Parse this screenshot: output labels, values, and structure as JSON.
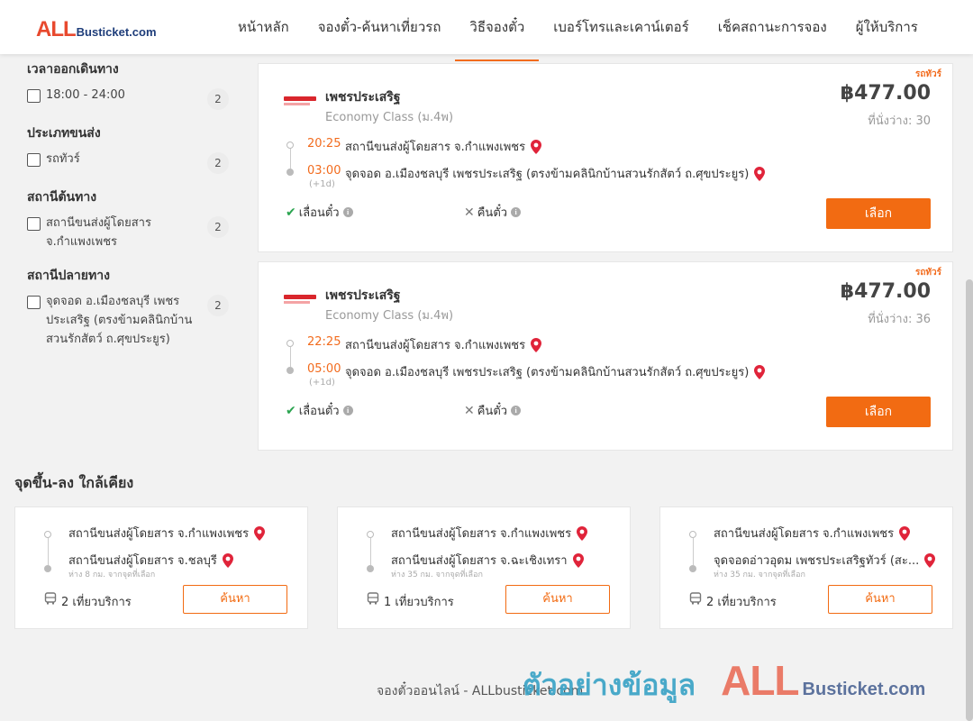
{
  "header": {
    "logo_all": "ALL",
    "logo_rest": "Busticket.com",
    "nav": [
      "หน้าหลัก",
      "จองตั๋ว-ค้นหาเที่ยวรถ",
      "วิธีจองตั๋ว",
      "เบอร์โทรและเคาน์เตอร์",
      "เช็คสถานะการจอง",
      "ผู้ให้บริการ"
    ],
    "active_nav": "วิธีจองตั๋ว"
  },
  "filters": {
    "departure_time": {
      "title": "เวลาออกเดินทาง",
      "option": "18:00 - 24:00",
      "count": "2"
    },
    "vehicle_type": {
      "title": "ประเภทขนส่ง",
      "option": "รถทัวร์",
      "count": "2"
    },
    "origin": {
      "title": "สถานีต้นทาง",
      "option": "สถานีขนส่งผู้โดยสาร จ.กำแพงเพชร",
      "count": "2"
    },
    "destination": {
      "title": "สถานีปลายทาง",
      "option": "จุดจอด อ.เมืองชลบุรี เพชรประเสริฐ (ตรงข้ามคลินิกบ้านสวนรักสัตว์ ถ.ศุขประยูร)",
      "count": "2"
    }
  },
  "trips": [
    {
      "tag": "รถทัวร์",
      "operator": "เพชรประเสริฐ",
      "class": "Economy Class (ม.4พ)",
      "price": "฿477.00",
      "seats": "ที่นั่งว่าง: 30",
      "depart_time": "20:25",
      "depart_place": "สถานีขนส่งผู้โดยสาร จ.กำแพงเพชร",
      "arrive_time": "03:00",
      "arrive_place": "จุดจอด อ.เมืองชลบุรี เพชรประเสริฐ (ตรงข้ามคลินิกบ้านสวนรักสัตว์ ถ.ศุขประยูร)",
      "next_day": "(+1d)",
      "reschedule": "เลื่อนตั๋ว",
      "refund": "คืนตั๋ว",
      "select_label": "เลือก"
    },
    {
      "tag": "รถทัวร์",
      "operator": "เพชรประเสริฐ",
      "class": "Economy Class (ม.4พ)",
      "price": "฿477.00",
      "seats": "ที่นั่งว่าง: 36",
      "depart_time": "22:25",
      "depart_place": "สถานีขนส่งผู้โดยสาร จ.กำแพงเพชร",
      "arrive_time": "05:00",
      "arrive_place": "จุดจอด อ.เมืองชลบุรี เพชรประเสริฐ (ตรงข้ามคลินิกบ้านสวนรักสัตว์ ถ.ศุขประยูร)",
      "next_day": "(+1d)",
      "reschedule": "เลื่อนตั๋ว",
      "refund": "คืนตั๋ว",
      "select_label": "เลือก"
    }
  ],
  "nearby": {
    "title": "จุดขึ้น-ลง ใกล้เคียง",
    "cards": [
      {
        "from": "สถานีขนส่งผู้โดยสาร จ.กำแพงเพชร",
        "to": "สถานีขนส่งผู้โดยสาร จ.ชลบุรี",
        "distance": "ห่าง 8 กม. จากจุดที่เลือก",
        "trips": "2 เที่ยวบริการ",
        "search_label": "ค้นหา"
      },
      {
        "from": "สถานีขนส่งผู้โดยสาร จ.กำแพงเพชร",
        "to": "สถานีขนส่งผู้โดยสาร จ.ฉะเชิงเทรา",
        "distance": "ห่าง 35 กม. จากจุดที่เลือก",
        "trips": "1 เที่ยวบริการ",
        "search_label": "ค้นหา"
      },
      {
        "from": "สถานีขนส่งผู้โดยสาร จ.กำแพงเพชร",
        "to": "จุดจอดอ่าวอุดม เพชรประเสริฐทัวร์ (สะ...",
        "distance": "ห่าง 35 กม. จากจุดที่เลือก",
        "trips": "2 เที่ยวบริการ",
        "search_label": "ค้นหา"
      }
    ]
  },
  "footer": {
    "text": "จองตั๋วออนไลน์ - ALLbusticket.com",
    "watermark_thai": "ตัวอย่างข้อมูล",
    "watermark_all": "ALL",
    "watermark_rest": "Busticket.com"
  },
  "colors": {
    "accent": "#f26b12",
    "pin": "#e0243a",
    "check": "#2aa44f",
    "logo_red": "#e8492e",
    "logo_navy": "#1e3d7a"
  }
}
